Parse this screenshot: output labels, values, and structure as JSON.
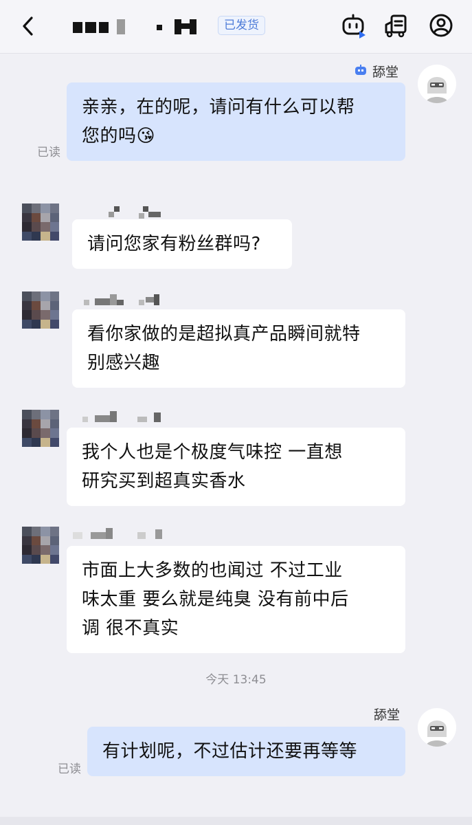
{
  "header": {
    "status_tag": "已发货",
    "icons": [
      "back-chevron-icon",
      "robot-icon",
      "delivery-truck-icon",
      "user-profile-icon"
    ]
  },
  "messages": [
    {
      "sender": "agent",
      "name": "舔堂",
      "read": "已读",
      "lines": [
        "亲亲，在的呢，请问有什么可以帮",
        "您的吗😘"
      ]
    },
    {
      "sender": "customer",
      "lines": [
        "请问您家有粉丝群吗?"
      ]
    },
    {
      "sender": "customer",
      "lines": [
        "看你家做的是超拟真产品瞬间就特",
        "别感兴趣"
      ]
    },
    {
      "sender": "customer",
      "lines": [
        "我个人也是个极度气味控 一直想",
        "研究买到超真实香水"
      ]
    },
    {
      "sender": "customer",
      "lines": [
        "市面上大多数的也闻过 不过工业",
        "味太重 要么就是纯臭 没有前中后",
        "调 很不真实"
      ]
    },
    {
      "sender": "agent",
      "name": "舔堂",
      "read": "已读",
      "lines": [
        "有计划呢，不过估计还要再等等"
      ]
    }
  ],
  "time_divider": "今天 13:45",
  "colors": {
    "agent_bubble": "#d7e4fd",
    "customer_bubble": "#ffffff",
    "background": "#f0f0f5",
    "accent": "#4d7bd8"
  }
}
